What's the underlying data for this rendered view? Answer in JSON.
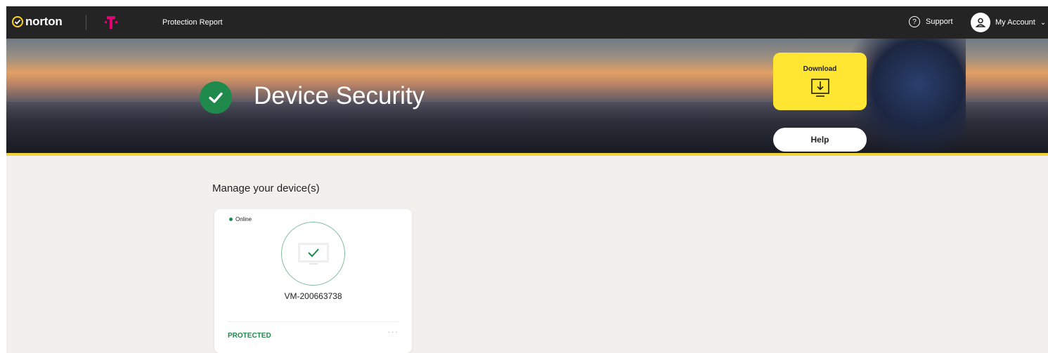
{
  "header": {
    "brand": "norton",
    "nav_title": "Protection Report",
    "support_label": "Support",
    "account_label": "My Account"
  },
  "hero": {
    "title": "Device Security",
    "download_label": "Download",
    "help_label": "Help"
  },
  "main": {
    "section_title": "Manage your device(s)",
    "devices": [
      {
        "status": "Online",
        "name": "VM-200663738",
        "protection": "PROTECTED"
      }
    ]
  },
  "colors": {
    "accent_yellow": "#ffe633",
    "protected_green": "#1f8a4c",
    "topbar": "#242424",
    "tmobile_magenta": "#e20074"
  },
  "icons": [
    "norton-check-icon",
    "t-mobile-logo-icon",
    "support-icon",
    "account-icon",
    "chevron-down-icon",
    "check-circle-icon",
    "download-monitor-icon",
    "monitor-check-icon",
    "more-options-icon"
  ]
}
